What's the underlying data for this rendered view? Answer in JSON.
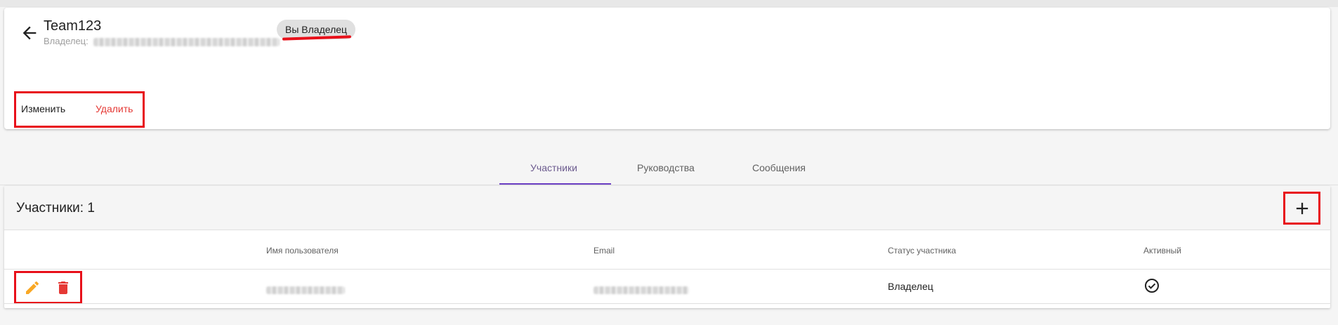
{
  "team": {
    "name": "Team123",
    "owner_label": "Владелец:",
    "owner_chip": "Вы Владелец",
    "edit_label": "Изменить",
    "delete_label": "Удалить"
  },
  "tabs": [
    {
      "label": "Участники",
      "active": true
    },
    {
      "label": "Руководства",
      "active": false
    },
    {
      "label": "Сообщения",
      "active": false
    }
  ],
  "members": {
    "title": "Участники: 1",
    "columns": [
      "Имя пользователя",
      "Email",
      "Статус участника",
      "Активный"
    ],
    "rows": [
      {
        "status": "Владелец",
        "active": true
      }
    ]
  },
  "icons": {
    "back": "arrow-left-icon",
    "add": "plus-icon",
    "edit": "pencil-icon",
    "delete": "trash-icon",
    "active": "check-circle-icon"
  },
  "colors": {
    "accent": "#6a3fc3",
    "danger": "#e53935",
    "edit_icon": "#f9a825",
    "highlight_box": "#e8101a"
  }
}
